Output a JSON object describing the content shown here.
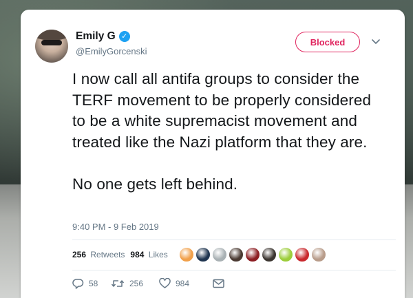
{
  "tweet": {
    "author": {
      "name": "Emily G",
      "handle": "@EmilyGorcenski",
      "verified": true
    },
    "follow_button_label": "Blocked",
    "text_paragraphs": [
      "I now call all antifa groups to consider the TERF movement to be properly considered to be a white supremacist movement and treated like the Nazi platform that they are.",
      "No one gets left behind."
    ],
    "timestamp": "9:40 PM - 9 Feb 2019",
    "stats": {
      "retweets_count": "256",
      "retweets_label": "Retweets",
      "likes_count": "984",
      "likes_label": "Likes"
    },
    "liker_avatars": [
      {
        "icon": "liker-avatar-1",
        "color": "#f1a04a"
      },
      {
        "icon": "liker-avatar-2",
        "color": "#1f3550"
      },
      {
        "icon": "liker-avatar-3",
        "color": "#a9b1b4"
      },
      {
        "icon": "liker-avatar-4",
        "color": "#4a3a32"
      },
      {
        "icon": "liker-avatar-5",
        "color": "#8c1d22"
      },
      {
        "icon": "liker-avatar-6",
        "color": "#3b3530"
      },
      {
        "icon": "liker-avatar-7",
        "color": "#9ccd3a"
      },
      {
        "icon": "liker-avatar-8",
        "color": "#c9282d"
      },
      {
        "icon": "liker-avatar-9",
        "color": "#b89c8a"
      }
    ],
    "actions": {
      "reply_count": "58",
      "retweet_count": "256",
      "like_count": "984"
    },
    "colors": {
      "blocked": "#e0245e",
      "verified": "#1da1f2",
      "secondary_text": "#657786"
    }
  }
}
